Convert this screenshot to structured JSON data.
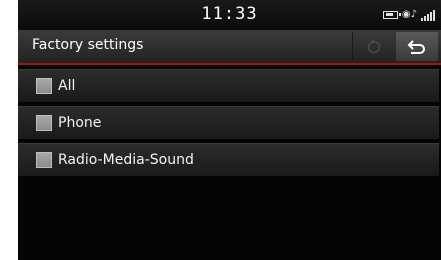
{
  "status": {
    "time": "11:33",
    "icons": [
      "battery-icon",
      "bluetooth-audio-icon",
      "signal-strength-icon"
    ]
  },
  "header": {
    "title": "Factory settings",
    "reset_icon": "reset-icon",
    "back_icon": "back-arrow-icon"
  },
  "items": [
    {
      "label": "All",
      "checked": false
    },
    {
      "label": "Phone",
      "checked": false
    },
    {
      "label": "Radio-Media-Sound",
      "checked": false
    }
  ],
  "colors": {
    "accent": "#a0141c",
    "background": "#050505",
    "checkbox": "#9a9a9a"
  }
}
